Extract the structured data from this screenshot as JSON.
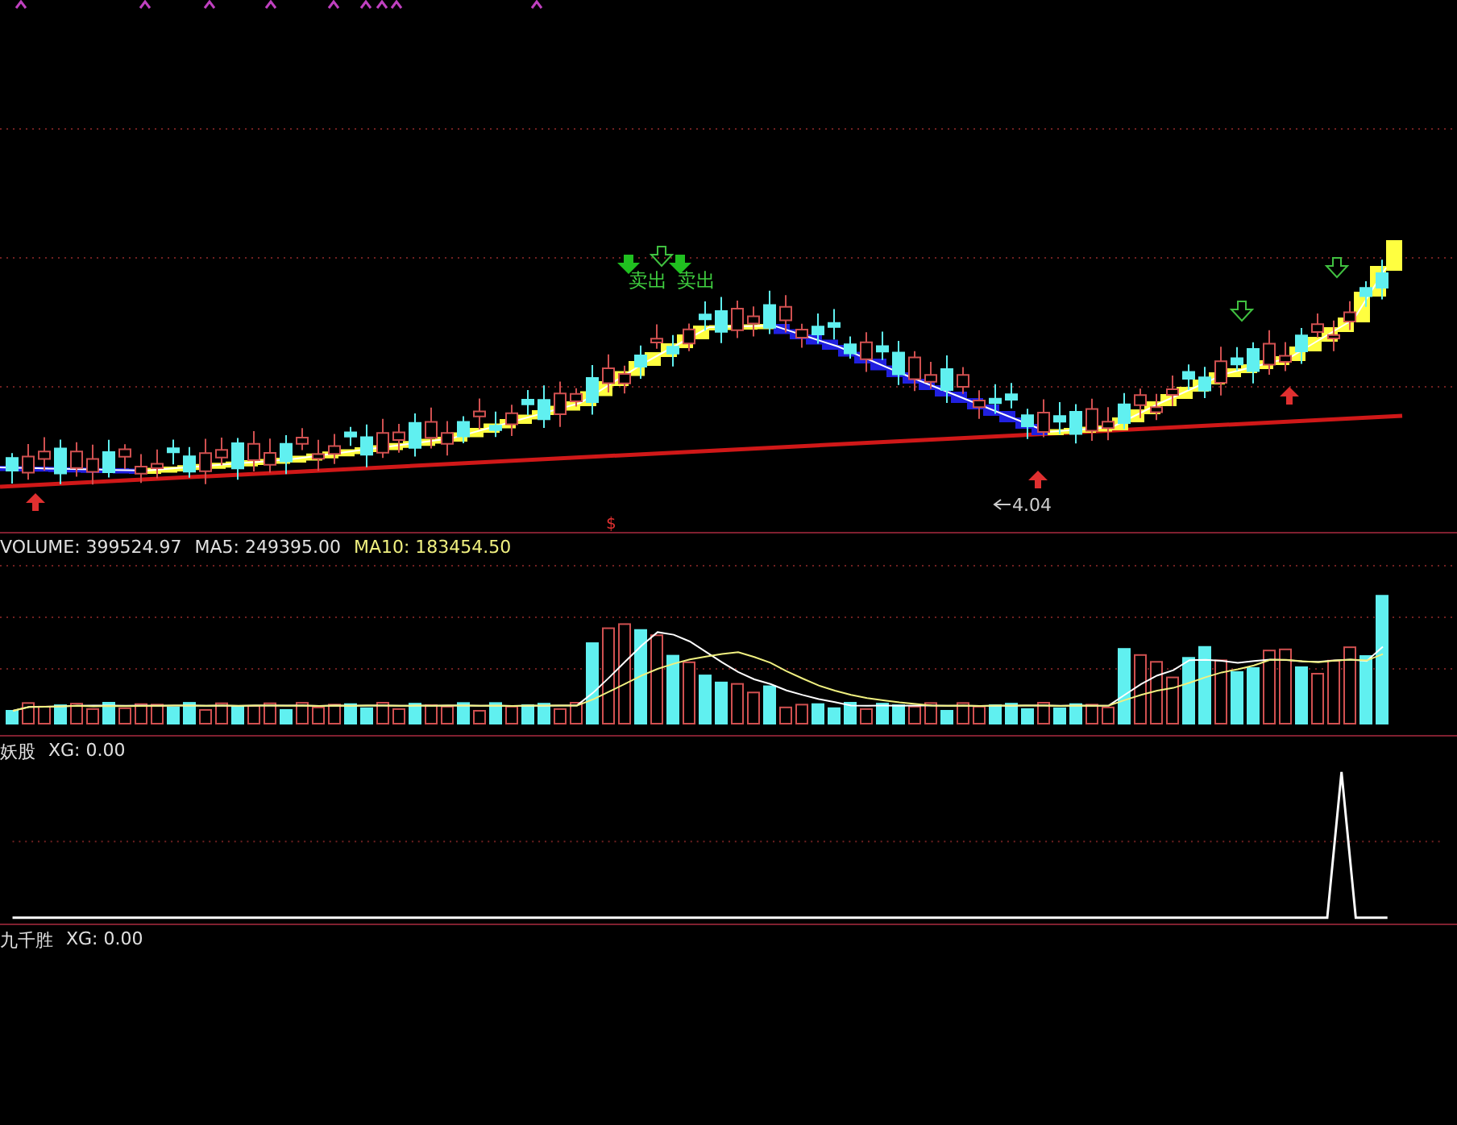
{
  "main_chart": {
    "sell_labels": [
      "卖出",
      "卖出"
    ],
    "low_price_label": "4.04",
    "signal_marker": "$"
  },
  "volume_panel": {
    "volume": "VOLUME: 399524.97",
    "ma5": "MA5: 249395.00",
    "ma10": "MA10: 183454.50"
  },
  "indicator_panels": [
    {
      "name": "妖股",
      "value": "XG: 0.00",
      "kind": "spike"
    },
    {
      "name": "九千胜",
      "value": "XG: 0.00",
      "kind": "blank"
    }
  ]
}
